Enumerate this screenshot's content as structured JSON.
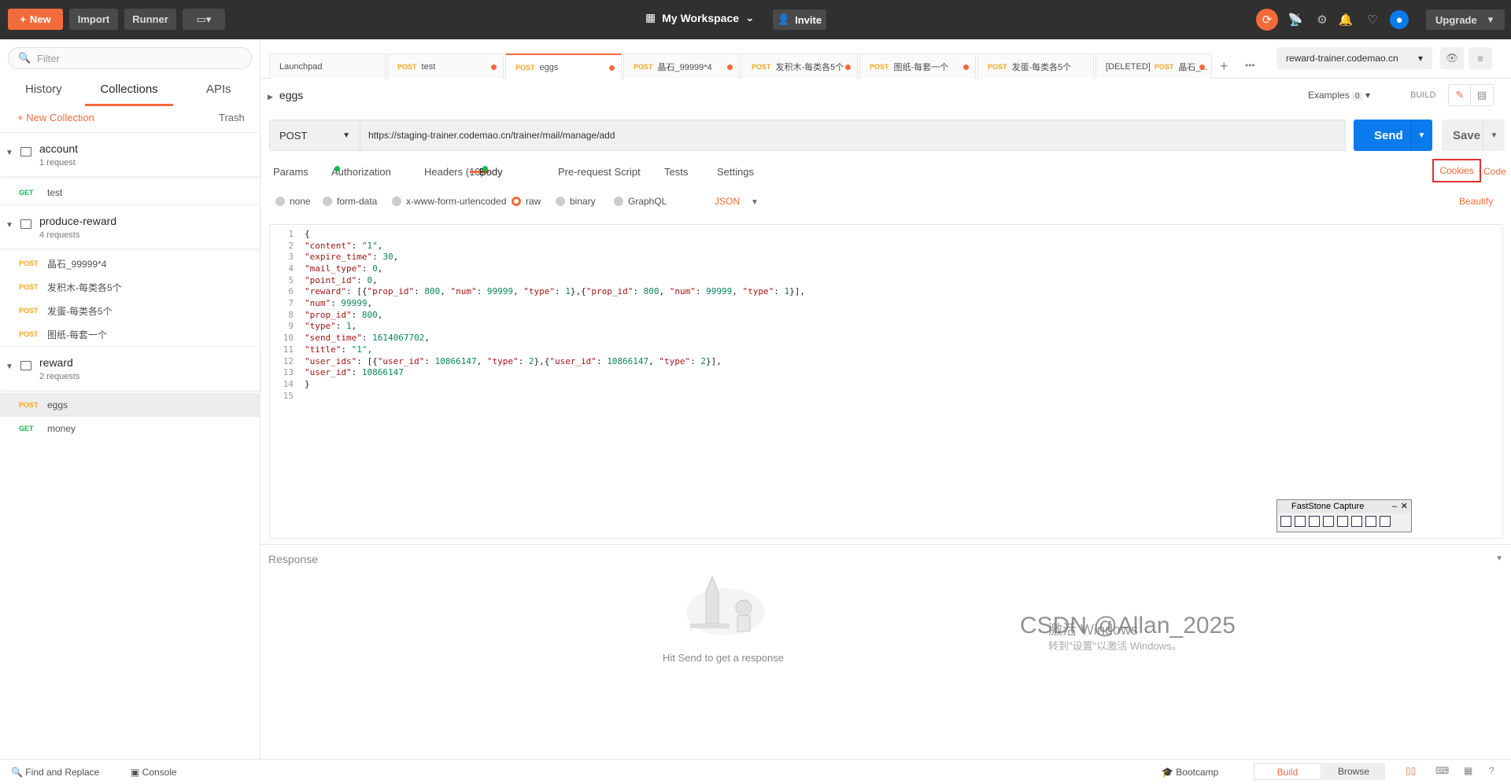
{
  "topbar": {
    "new_label": "New",
    "import_label": "Import",
    "runner_label": "Runner",
    "workspace": "My Workspace",
    "invite_label": "Invite",
    "upgrade_label": "Upgrade"
  },
  "sidebar": {
    "filter_placeholder": "Filter",
    "tabs": [
      "History",
      "Collections",
      "APIs"
    ],
    "new_collection": "+ New Collection",
    "trash": "Trash",
    "collections": [
      {
        "name": "account",
        "count": "1 request",
        "requests": [
          {
            "method": "GET",
            "name": "test"
          }
        ]
      },
      {
        "name": "produce-reward",
        "count": "4 requests",
        "requests": [
          {
            "method": "POST",
            "name": "晶石_99999*4"
          },
          {
            "method": "POST",
            "name": "发积木-每类各5个"
          },
          {
            "method": "POST",
            "name": "发蛋-每类各5个"
          },
          {
            "method": "POST",
            "name": "图纸-每套一个"
          }
        ]
      },
      {
        "name": "reward",
        "count": "2 requests",
        "requests": [
          {
            "method": "POST",
            "name": "eggs"
          },
          {
            "method": "GET",
            "name": "money"
          }
        ]
      }
    ]
  },
  "tabs": [
    {
      "method": "",
      "name": "Launchpad"
    },
    {
      "method": "POST",
      "name": "test"
    },
    {
      "method": "POST",
      "name": "eggs"
    },
    {
      "method": "POST",
      "name": "晶石_99999*4"
    },
    {
      "method": "POST",
      "name": "发积木-每类各5个"
    },
    {
      "method": "POST",
      "name": "图纸-每套一个"
    },
    {
      "method": "POST",
      "name": "发蛋-每类各5个"
    },
    {
      "method": "POST",
      "name": "晶石_..."
    }
  ],
  "deleted_prefix": "[DELETED]",
  "environment": "reward-trainer.codemao.cn",
  "request": {
    "name": "eggs",
    "examples": "Examples",
    "examples_count": "0",
    "build": "BUILD",
    "method": "POST",
    "url": "https://staging-trainer.codemao.cn/trainer/mail/manage/add",
    "send": "Send",
    "save": "Save"
  },
  "req_tabs": [
    "Params",
    "Authorization",
    "Headers (10)",
    "Body",
    "Pre-request Script",
    "Tests",
    "Settings"
  ],
  "cookies": "Cookies",
  "code": "Code",
  "body_modes": [
    "none",
    "form-data",
    "x-www-form-urlencoded",
    "raw",
    "binary",
    "GraphQL"
  ],
  "body_format": "JSON",
  "beautify": "Beautify",
  "code_lines": [
    "{",
    "\"content\": \"1\",",
    "\"expire_time\": 30,",
    "\"mail_type\": 0,",
    "\"point_id\": 0,",
    "\"reward\": [{\"prop_id\": 800, \"num\": 99999, \"type\": 1},{\"prop_id\": 800, \"num\": 99999, \"type\": 1}],",
    "\"num\": 99999,",
    "\"prop_id\": 800,",
    "\"type\": 1,",
    "\"send_time\": 1614067702,",
    "\"title\": \"1\",",
    "\"user_ids\": [{\"user_id\": 10866147, \"type\": 2},{\"user_id\": 10866147, \"type\": 2}],",
    "\"user_id\": 10866147",
    "}",
    ""
  ],
  "response": {
    "title": "Response",
    "hint": "Hit Send to get a response"
  },
  "watermark": {
    "line1": "激活 Windows",
    "line2": "转到\"设置\"以激活 Windows。"
  },
  "csdn": "CSDN @Allan_2025",
  "faststone": "FastStone Capture",
  "statusbar": {
    "find_replace": "Find and Replace",
    "console": "Console",
    "bootcamp": "Bootcamp",
    "build": "Build",
    "browse": "Browse"
  }
}
